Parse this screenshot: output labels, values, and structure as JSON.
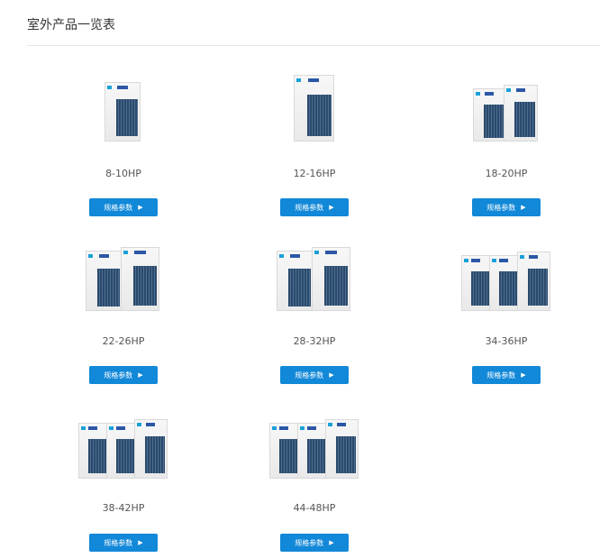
{
  "header": {
    "title": "室外产品一览表"
  },
  "products": [
    {
      "model": "8-10HP",
      "button_label": "规格参数",
      "modules": 1
    },
    {
      "model": "12-16HP",
      "button_label": "规格参数",
      "modules": 1
    },
    {
      "model": "18-20HP",
      "button_label": "规格参数",
      "modules": 2
    },
    {
      "model": "22-26HP",
      "button_label": "规格参数",
      "modules": 2
    },
    {
      "model": "28-32HP",
      "button_label": "规格参数",
      "modules": 2
    },
    {
      "model": "34-36HP",
      "button_label": "规格参数",
      "modules": 3
    },
    {
      "model": "38-42HP",
      "button_label": "规格参数",
      "modules": 3
    },
    {
      "model": "44-48HP",
      "button_label": "规格参数",
      "modules": 3
    }
  ],
  "icons": {
    "button_arrow": "play-arrow-icon"
  },
  "colors": {
    "button": "#1288d8",
    "divider": "#e6e6e6"
  }
}
